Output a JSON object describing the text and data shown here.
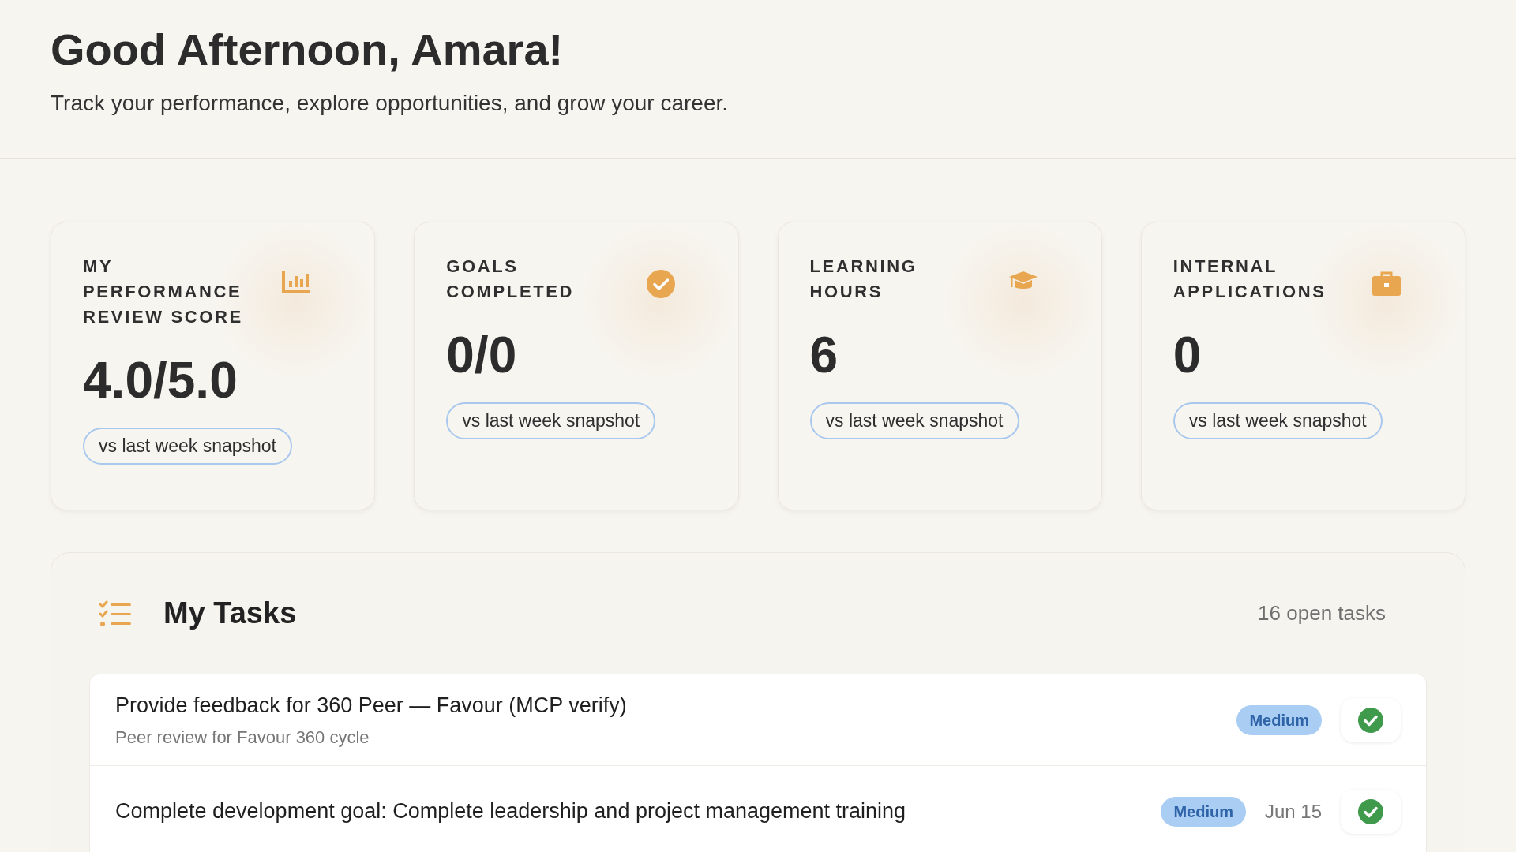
{
  "header": {
    "title": "Good Afternoon, Amara!",
    "subtitle": "Track your performance, explore opportunities, and grow your career."
  },
  "stats": [
    {
      "kind": "chart",
      "label": "MY PERFORMANCE REVIEW SCORE",
      "value": "4.0/5.0",
      "pill": "vs last week snapshot"
    },
    {
      "kind": "check",
      "label": "GOALS COMPLETED",
      "value": "0/0",
      "pill": "vs last week snapshot"
    },
    {
      "kind": "cap",
      "label": "LEARNING HOURS",
      "value": "6",
      "pill": "vs last week snapshot"
    },
    {
      "kind": "briefcase",
      "label": "INTERNAL APPLICATIONS",
      "value": "0",
      "pill": "vs last week snapshot"
    }
  ],
  "tasks": {
    "title": "My Tasks",
    "count": "16 open tasks",
    "items": [
      {
        "title": "Provide feedback for 360 Peer — Favour (MCP verify)",
        "subtitle": "Peer review for Favour 360 cycle",
        "priority": "Medium"
      },
      {
        "title": "Complete development goal: Complete leadership and project management training",
        "priority": "Medium",
        "due": "Jun 15"
      }
    ]
  }
}
